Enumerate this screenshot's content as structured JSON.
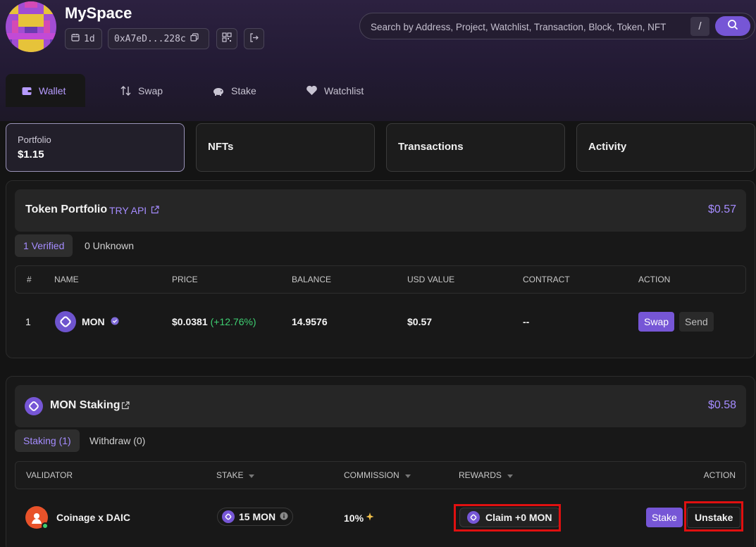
{
  "app": {
    "title": "MySpace"
  },
  "header": {
    "age_chip": "1d",
    "address_chip": "0xA7eD...228c",
    "search_placeholder": "Search by Address, Project, Watchlist, Transaction, Block, Token, NFT",
    "search_shortcut": "/"
  },
  "nav": {
    "tabs": [
      {
        "label": "Wallet",
        "icon": "wallet-icon",
        "active": true
      },
      {
        "label": "Swap",
        "icon": "swap-arrows-icon",
        "active": false
      },
      {
        "label": "Stake",
        "icon": "piggy-bank-icon",
        "active": false
      },
      {
        "label": "Watchlist",
        "icon": "heart-icon",
        "active": false
      }
    ]
  },
  "cards": [
    {
      "label": "Portfolio",
      "value": "$1.15",
      "active": true
    },
    {
      "label": "NFTs"
    },
    {
      "label": "Transactions"
    },
    {
      "label": "Activity"
    }
  ],
  "token_portfolio": {
    "title": "Token Portfolio",
    "try_api": "TRY API",
    "total": "$0.57",
    "tabs": [
      "1 Verified",
      "0 Unknown"
    ],
    "columns": [
      "#",
      "NAME",
      "PRICE",
      "BALANCE",
      "USD VALUE",
      "CONTRACT",
      "ACTION"
    ],
    "rows": [
      {
        "index": "1",
        "name": "MON",
        "price": "$0.0381",
        "change": "(+12.76%)",
        "balance": "14.9576",
        "usd_value": "$0.57",
        "contract": "--",
        "actions": [
          "Swap",
          "Send"
        ]
      }
    ]
  },
  "staking": {
    "title": "MON Staking",
    "total": "$0.58",
    "tabs": [
      "Staking (1)",
      "Withdraw (0)"
    ],
    "columns": [
      "VALIDATOR",
      "STAKE",
      "COMMISSION",
      "REWARDS",
      "ACTION"
    ],
    "rows": [
      {
        "validator": "Coinage x DAIC",
        "stake": "15 MON",
        "commission": "10%",
        "rewards": "Claim +0 MON",
        "actions": [
          "Stake",
          "Unstake"
        ]
      }
    ]
  },
  "colors": {
    "accent": "#7656d6",
    "accent_text": "#a58cff",
    "positive": "#3fcf72",
    "highlight": "#e01010"
  }
}
